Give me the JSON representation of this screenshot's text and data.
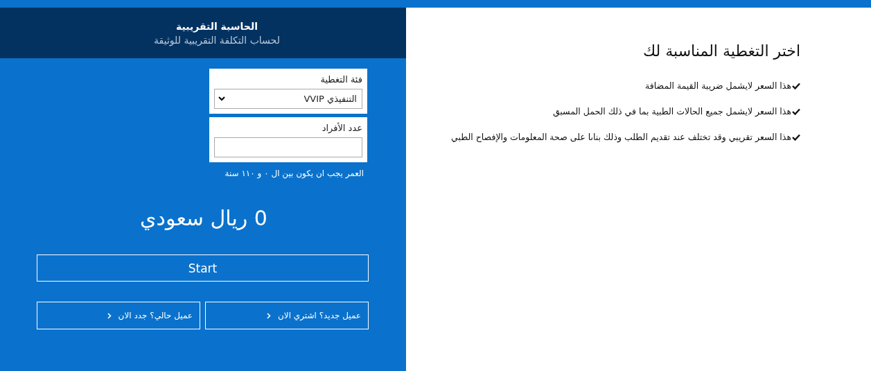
{
  "calculator": {
    "title": "الحاسبة التقريبية",
    "subtitle": "لحساب التكلفة التقريبية للوثيقة",
    "coverage": {
      "label": "فئة التغطية",
      "value": "التنفيذي VVIP"
    },
    "members": {
      "label": "عدد الأفراد"
    },
    "age_hint": "العمر يجب ان يكون بين ال ٠ و  ١١٠ سنة",
    "price": "0 ريال سعودي",
    "start_button": "Start",
    "buttons": [
      "عميل جديد؟ اشتري الان",
      "عميل حالي؟ جدد الان"
    ]
  },
  "info": {
    "title": "اختر التغطية المناسبة لك",
    "notes": [
      "هذا السعر لايشمل ضريبة القيمة المضافة",
      "هذا السعر لايشمل جميع الحالات الطبية بما في ذلك الحمل المسبق",
      "هذا السعر تقريبي وقد تختلف عند تقديم الطلب وذلك بناىا على صحة المعلومات والإفصاح الطبي"
    ]
  }
}
